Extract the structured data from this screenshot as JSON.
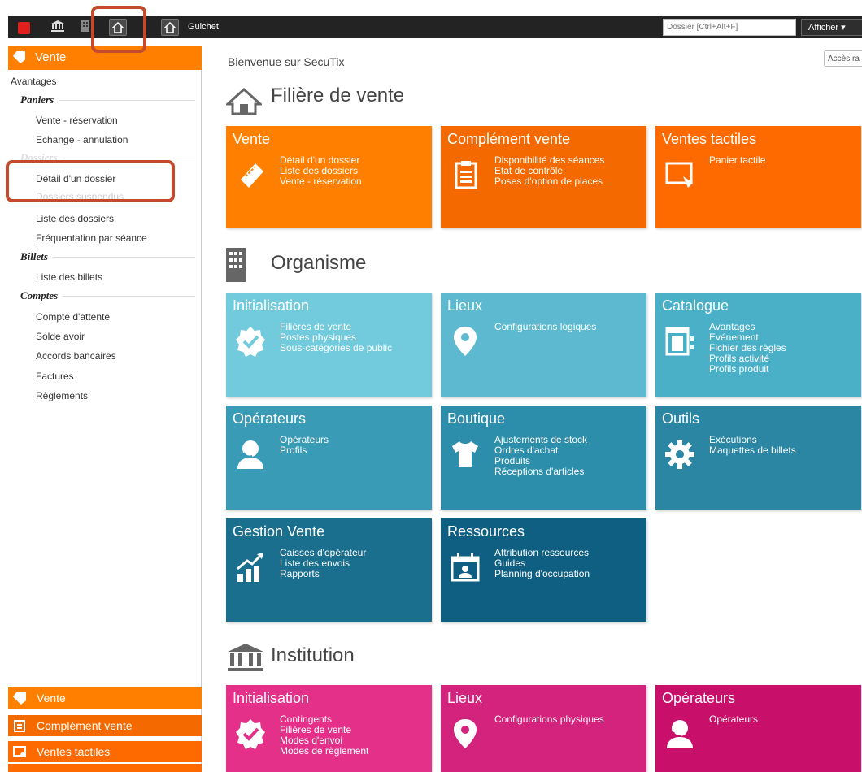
{
  "topbar": {
    "title": "Guichet",
    "search_placeholder": "Dossier [Ctrl+Alt+F]",
    "afficher": "Afficher ▾"
  },
  "sidebar": {
    "header": "Vente",
    "items": {
      "avantages": "Avantages",
      "paniers": "Paniers",
      "vente_reservation": "Vente - réservation",
      "echange": "Echange - annulation",
      "dossiers": "Dossiers",
      "detail_dossier": "Détail d'un dossier",
      "dossiers_suspendus": "Dossiers suspendus",
      "liste_dossiers": "Liste des dossiers",
      "frequentation": "Fréquentation par séance",
      "billets": "Billets",
      "liste_billets": "Liste des billets",
      "comptes": "Comptes",
      "compte_attente": "Compte d'attente",
      "solde_avoir": "Solde avoir",
      "accords": "Accords bancaires",
      "factures": "Factures",
      "reglements": "Règlements"
    },
    "bottom": {
      "vente": "Vente",
      "complement": "Complément vente",
      "tactiles": "Ventes tactiles"
    }
  },
  "main": {
    "welcome": "Bienvenue sur SecuTix",
    "acces": "Accès ra",
    "sections": {
      "filiere": "Filière de vente",
      "organisme": "Organisme",
      "institution": "Institution"
    },
    "tiles": {
      "vente": {
        "title": "Vente",
        "links": [
          "Détail d'un dossier",
          "Liste des dossiers",
          "Vente - réservation"
        ]
      },
      "complement": {
        "title": "Complément vente",
        "links": [
          "Disponibilité des séances",
          "Etat de contrôle",
          "Poses d'option de places"
        ]
      },
      "tactiles": {
        "title": "Ventes tactiles",
        "links": [
          "Panier tactile"
        ]
      },
      "org_init": {
        "title": "Initialisation",
        "links": [
          "Filières de vente",
          "Postes physiques",
          "Sous-catégories de public"
        ]
      },
      "org_lieux": {
        "title": "Lieux",
        "links": [
          "Configurations logiques"
        ]
      },
      "catalogue": {
        "title": "Catalogue",
        "links": [
          "Avantages",
          "Evénement",
          "Fichier des règles",
          "Profils activité",
          "Profils produit"
        ]
      },
      "org_ops": {
        "title": "Opérateurs",
        "links": [
          "Opérateurs",
          "Profils"
        ]
      },
      "boutique": {
        "title": "Boutique",
        "links": [
          "Ajustements de stock",
          "Ordres d'achat",
          "Produits",
          "Réceptions d'articles"
        ]
      },
      "outils": {
        "title": "Outils",
        "links": [
          "Exécutions",
          "Maquettes de billets"
        ]
      },
      "gestion": {
        "title": "Gestion Vente",
        "links": [
          "Caisses d'opérateur",
          "Liste des envois",
          "Rapports"
        ]
      },
      "ressources": {
        "title": "Ressources",
        "links": [
          "Attribution ressources",
          "Guides",
          "Planning d'occupation"
        ]
      },
      "inst_init": {
        "title": "Initialisation",
        "links": [
          "Contingents",
          "Filières de vente",
          "Modes d'envoi",
          "Modes de règlement"
        ]
      },
      "inst_lieux": {
        "title": "Lieux",
        "links": [
          "Configurations physiques"
        ]
      },
      "inst_ops": {
        "title": "Opérateurs",
        "links": [
          "Opérateurs"
        ]
      }
    }
  }
}
